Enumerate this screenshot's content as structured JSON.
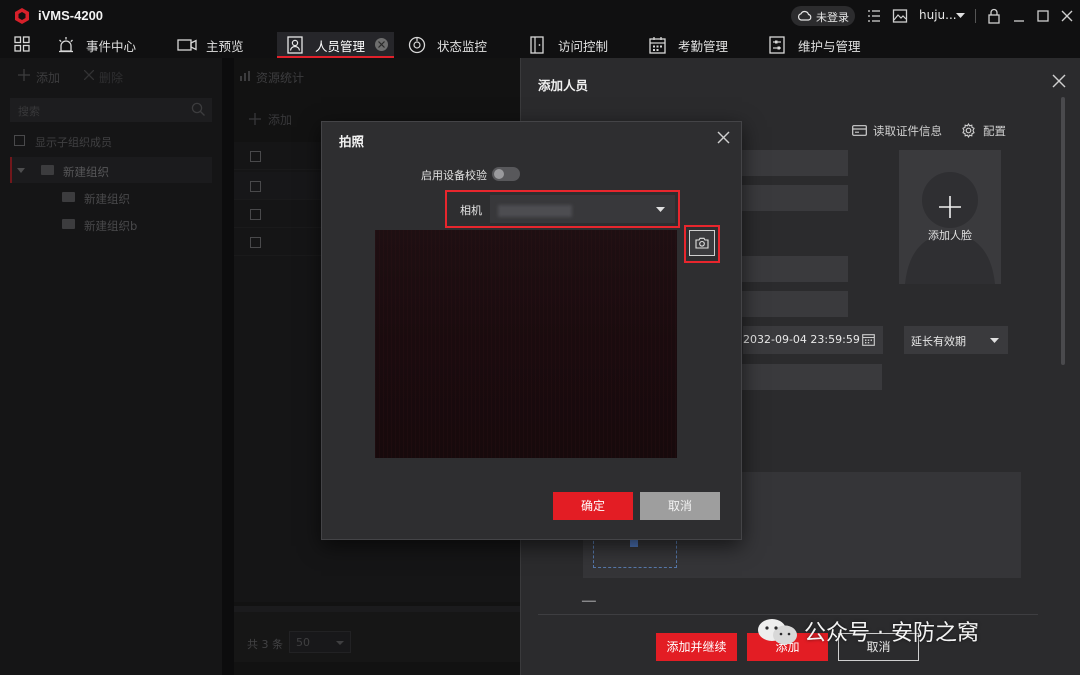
{
  "app": {
    "name": "iVMS-4200"
  },
  "titlebar": {
    "login_label": "未登录",
    "user": "huju..."
  },
  "tabs": [
    {
      "label": "事件中心"
    },
    {
      "label": "主预览"
    },
    {
      "label": "人员管理"
    },
    {
      "label": "状态监控"
    },
    {
      "label": "访问控制"
    },
    {
      "label": "考勤管理"
    },
    {
      "label": "维护与管理"
    }
  ],
  "left_panel": {
    "add_label": "添加",
    "delete_label": "删除",
    "search_placeholder": "搜索",
    "show_sub_members": "显示子组织成员",
    "tree": [
      {
        "label": "新建组织"
      },
      {
        "label": "新建组织"
      },
      {
        "label": "新建组织b"
      }
    ]
  },
  "mid_panel": {
    "title": "资源统计",
    "add_label": "添加",
    "total_label": "共 3 条",
    "page_size": "50"
  },
  "drawer": {
    "title": "添加人员",
    "read_id_label": "读取证件信息",
    "config_label": "配置",
    "add_face_label": "添加人脸",
    "end_datetime": "2032-09-04 23:59:59",
    "extend_option": "延长有效期",
    "add_continue_label": "添加并继续",
    "add_label": "添加",
    "cancel_label": "取消"
  },
  "dialog": {
    "title": "拍照",
    "device_verify_label": "启用设备校验",
    "device_verify_on": false,
    "camera_label": "相机",
    "camera_value": "",
    "ok_label": "确定",
    "cancel_label": "取消"
  },
  "watermark": {
    "text": "公众号 · 安防之窝"
  },
  "colors": {
    "accent_red": "#e31d24",
    "highlight_red": "#e8262d",
    "dialog_bg": "#2e2e30",
    "drawer_bg": "#2b2b2d"
  }
}
